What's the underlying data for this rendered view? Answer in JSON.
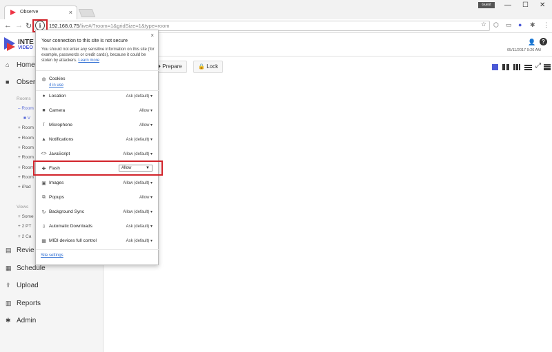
{
  "browser": {
    "tab_title": "Observe",
    "tab_close": "×",
    "user_badge": "Guest",
    "win_min": "—",
    "win_max": "☐",
    "win_close": "✕",
    "url_host": "192.168.0.75",
    "url_path": "/live#/?room=1&gridSize=1&type=room",
    "star": "☆",
    "menu": "⋮"
  },
  "app": {
    "logo_text": "INTE",
    "logo_sub": "VIDEO",
    "timestamp": "05/11/2017 9:26 AM",
    "toolbar": {
      "prepare": "Prepare",
      "lock": "Lock"
    },
    "sidebar": {
      "items": [
        {
          "label": "Home",
          "icon": "home-icon"
        },
        {
          "label": "Obser",
          "icon": "video-camera-icon"
        },
        {
          "label": "Revie",
          "icon": "review-icon"
        },
        {
          "label": "Schedule",
          "icon": "calendar-icon"
        },
        {
          "label": "Upload",
          "icon": "upload-icon"
        },
        {
          "label": "Reports",
          "icon": "bar-chart-icon"
        },
        {
          "label": "Admin",
          "icon": "gear-icon"
        }
      ],
      "rooms_section": "Rooms",
      "rooms": [
        "Room",
        "V",
        "Room",
        "Room",
        "Room",
        "Room",
        "Room",
        "Room",
        "iPad"
      ],
      "views_section": "Views",
      "views": [
        "Some",
        "2 PT",
        "2 Ca"
      ]
    }
  },
  "popup": {
    "close": "×",
    "title": "Your connection to this site is not secure",
    "description": "You should not enter any sensitive information on this site (for example, passwords or credit cards), because it could be stolen by attackers.",
    "learn_more": "Learn more",
    "cookies_label": "Cookies",
    "cookies_link": "4 in use",
    "permissions": [
      {
        "label": "Location",
        "value": "Ask (default)",
        "icon": "location-pin-icon"
      },
      {
        "label": "Camera",
        "value": "Allow",
        "icon": "camera-icon"
      },
      {
        "label": "Microphone",
        "value": "Allow",
        "icon": "microphone-icon"
      },
      {
        "label": "Notifications",
        "value": "Ask (default)",
        "icon": "bell-icon"
      },
      {
        "label": "JavaScript",
        "value": "Allow (default)",
        "icon": "code-icon"
      },
      {
        "label": "Flash",
        "value": "Allow",
        "icon": "puzzle-icon"
      },
      {
        "label": "Images",
        "value": "Allow (default)",
        "icon": "image-icon"
      },
      {
        "label": "Popups",
        "value": "Allow",
        "icon": "popup-icon"
      },
      {
        "label": "Background Sync",
        "value": "Allow (default)",
        "icon": "sync-icon"
      },
      {
        "label": "Automatic Downloads",
        "value": "Ask (default)",
        "icon": "download-icon"
      },
      {
        "label": "MIDI devices full control",
        "value": "Ask (default)",
        "icon": "midi-icon"
      }
    ],
    "site_settings": "Site settings"
  },
  "colors": {
    "accent": "#4b59d6",
    "highlight": "#d2232a",
    "link": "#2a6bd2"
  }
}
